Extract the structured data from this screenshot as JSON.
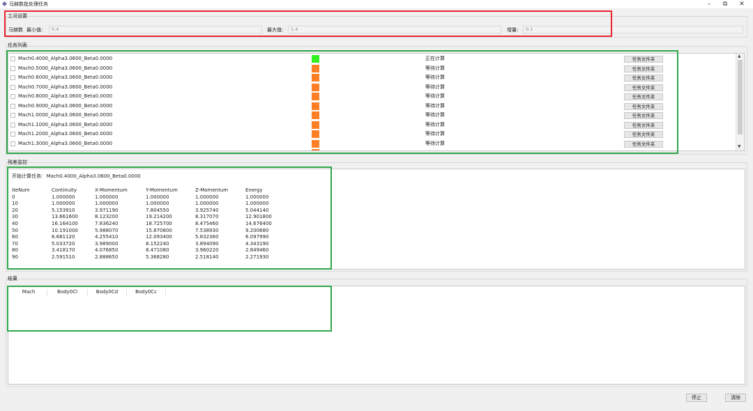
{
  "window": {
    "title": "马赫数批处理任务",
    "min_glyph": "–",
    "max_glyph": "⧉",
    "close_glyph": "✕"
  },
  "conditions": {
    "group_label": "工况设置",
    "mach_label": "马赫数",
    "min_label": "最小值:",
    "min_value": "0.4",
    "max_label": "最大值:",
    "max_value": "1.4",
    "step_label": "增量:",
    "step_value": "0.1"
  },
  "task_list": {
    "group_label": "任务列表",
    "folder_button_label": "任务文件夹",
    "rows": [
      {
        "name": "Mach0.4000_Alpha3.0600_Beta0.0000",
        "status": "正在计算",
        "color": "#33ee22"
      },
      {
        "name": "Mach0.5000_Alpha3.0600_Beta0.0000",
        "status": "等待计算",
        "color": "#ff7f27"
      },
      {
        "name": "Mach0.6000_Alpha3.0600_Beta0.0000",
        "status": "等待计算",
        "color": "#ff7f27"
      },
      {
        "name": "Mach0.7000_Alpha3.0600_Beta0.0000",
        "status": "等待计算",
        "color": "#ff7f27"
      },
      {
        "name": "Mach0.8000_Alpha3.0600_Beta0.0000",
        "status": "等待计算",
        "color": "#ff7f27"
      },
      {
        "name": "Mach0.9000_Alpha3.0600_Beta0.0000",
        "status": "等待计算",
        "color": "#ff7f27"
      },
      {
        "name": "Mach1.0000_Alpha3.0600_Beta0.0000",
        "status": "等待计算",
        "color": "#ff7f27"
      },
      {
        "name": "Mach1.1000_Alpha3.0600_Beta0.0000",
        "status": "等待计算",
        "color": "#ff7f27"
      },
      {
        "name": "Mach1.2000_Alpha3.0600_Beta0.0000",
        "status": "等待计算",
        "color": "#ff7f27"
      },
      {
        "name": "Mach1.3000_Alpha3.0600_Beta0.0000",
        "status": "等待计算",
        "color": "#ff7f27"
      }
    ]
  },
  "residual": {
    "group_label": "残差监控",
    "start_label": "开始计算任务:",
    "start_task": "Mach0.4000_Alpha3.0600_Beta0.0000",
    "columns": [
      "IteNum",
      "Continuity",
      "X-Momentum",
      "Y-Momentum",
      "Z-Momentum",
      "Energy"
    ],
    "rows": [
      [
        "0",
        "1.000000",
        "1.000000",
        "1.000000",
        "1.000000",
        "1.000000"
      ],
      [
        "10",
        "1.000000",
        "1.000000",
        "1.000000",
        "1.000000",
        "1.000000"
      ],
      [
        "20",
        "5.153910",
        "3.971190",
        "7.804550",
        "3.925740",
        "5.044140"
      ],
      [
        "30",
        "13.661600",
        "8.123200",
        "19.214200",
        "8.317070",
        "12.901800"
      ],
      [
        "40",
        "16.164100",
        "7.836240",
        "18.725700",
        "8.475460",
        "14.676400"
      ],
      [
        "50",
        "10.191000",
        "5.988070",
        "15.870800",
        "7.538930",
        "9.200680"
      ],
      [
        "60",
        "6.681120",
        "4.255410",
        "12.093400",
        "5.832360",
        "6.097990"
      ],
      [
        "70",
        "5.033720",
        "3.989000",
        "8.152240",
        "3.894090",
        "4.343190"
      ],
      [
        "80",
        "3.418170",
        "4.076850",
        "8.471080",
        "3.960220",
        "2.849460"
      ],
      [
        "90",
        "2.591510",
        "2.888650",
        "5.368280",
        "2.518140",
        "2.271930"
      ]
    ]
  },
  "results": {
    "group_label": "结果",
    "columns": [
      "Mach",
      "Body0Cl",
      "Body0Cd",
      "Body0Cc"
    ]
  },
  "buttons": {
    "stop": "停止",
    "clear": "清除"
  },
  "colors": {
    "annotation_red": "#e8262d",
    "annotation_green": "#2ea64a",
    "running": "#33ee22",
    "waiting": "#ff7f27"
  }
}
